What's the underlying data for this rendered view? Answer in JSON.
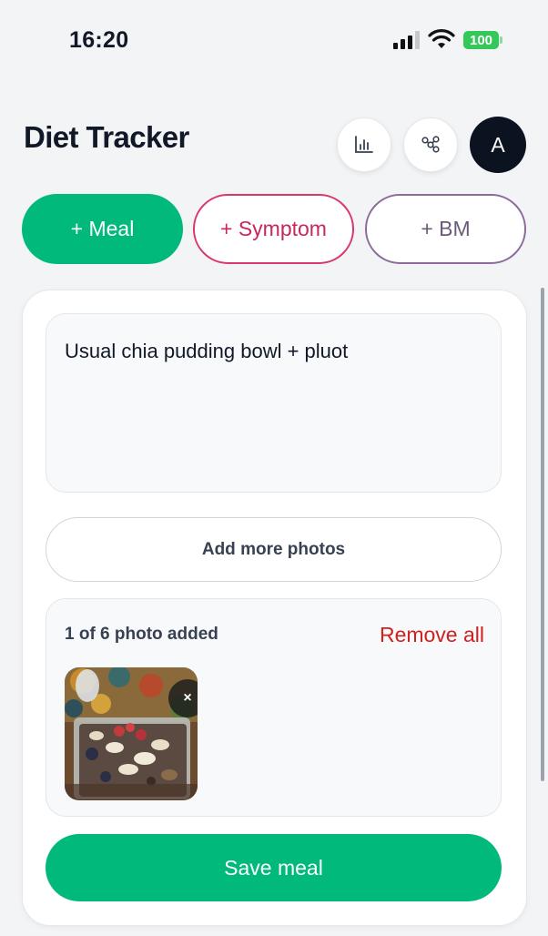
{
  "status_bar": {
    "time": "16:20",
    "battery": "100"
  },
  "header": {
    "title": "Diet Tracker",
    "chart_icon": "bar-chart-icon",
    "share_icon": "share-nodes-icon",
    "avatar_initial": "A"
  },
  "tabs": [
    {
      "label": "+ Meal",
      "active": true,
      "color": "#00b97a"
    },
    {
      "label": "+ Symptom",
      "active": false,
      "color": "#d9376e"
    },
    {
      "label": "+ BM",
      "active": false,
      "color": "#8c6b9b"
    }
  ],
  "form": {
    "meal_text": "Usual chia pudding bowl + pluot",
    "add_photos_label": "Add more photos",
    "photos": {
      "count_text": "1 of 6 photo added",
      "remove_all_label": "Remove all",
      "remove_icon": "close-icon",
      "close_glyph": "×"
    },
    "save_label": "Save meal"
  },
  "colors": {
    "accent": "#00b97a",
    "danger": "#d21f1f"
  }
}
